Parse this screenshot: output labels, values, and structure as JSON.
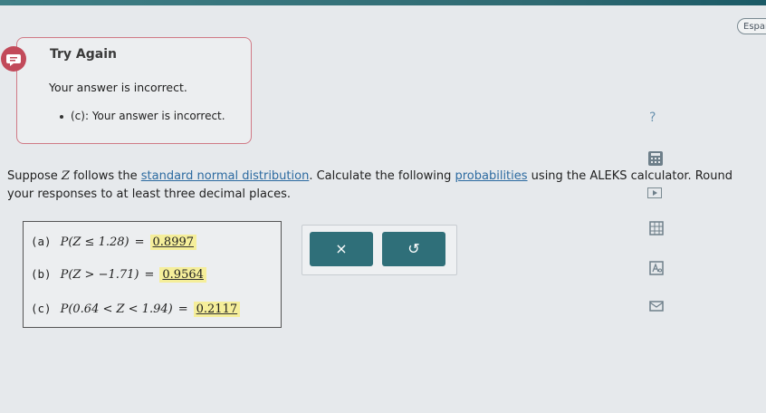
{
  "header": {
    "language_button": "Españ"
  },
  "feedback": {
    "title": "Try Again",
    "message": "Your answer is incorrect.",
    "items": [
      "(c): Your answer is incorrect."
    ]
  },
  "sidebar": {
    "help": "?",
    "icons": [
      "calculator-icon",
      "play-icon",
      "grid-icon",
      "text-size-icon",
      "mail-icon"
    ]
  },
  "question": {
    "text_1": "Suppose ",
    "var": "Z",
    "text_2": " follows the ",
    "link_1": "standard normal distribution",
    "text_3": ". Calculate the following ",
    "link_2": "probabilities",
    "text_4": " using the ALEKS calculator. Round your responses to at least three decimal places."
  },
  "answers": [
    {
      "label": "(a)",
      "expr": "P(Z ≤ 1.28)",
      "value": "0.8997"
    },
    {
      "label": "(b)",
      "expr": "P(Z > −1.71)",
      "value": "0.9564"
    },
    {
      "label": "(c)",
      "expr": "P(0.64 < Z < 1.94)",
      "value": "0.2117"
    }
  ],
  "buttons": {
    "clear": "×",
    "undo": "↺"
  },
  "colors": {
    "accent": "#2f6f79",
    "highlight": "#f5ee9a",
    "alert_border": "#d07a86",
    "link": "#2c6aa0"
  }
}
